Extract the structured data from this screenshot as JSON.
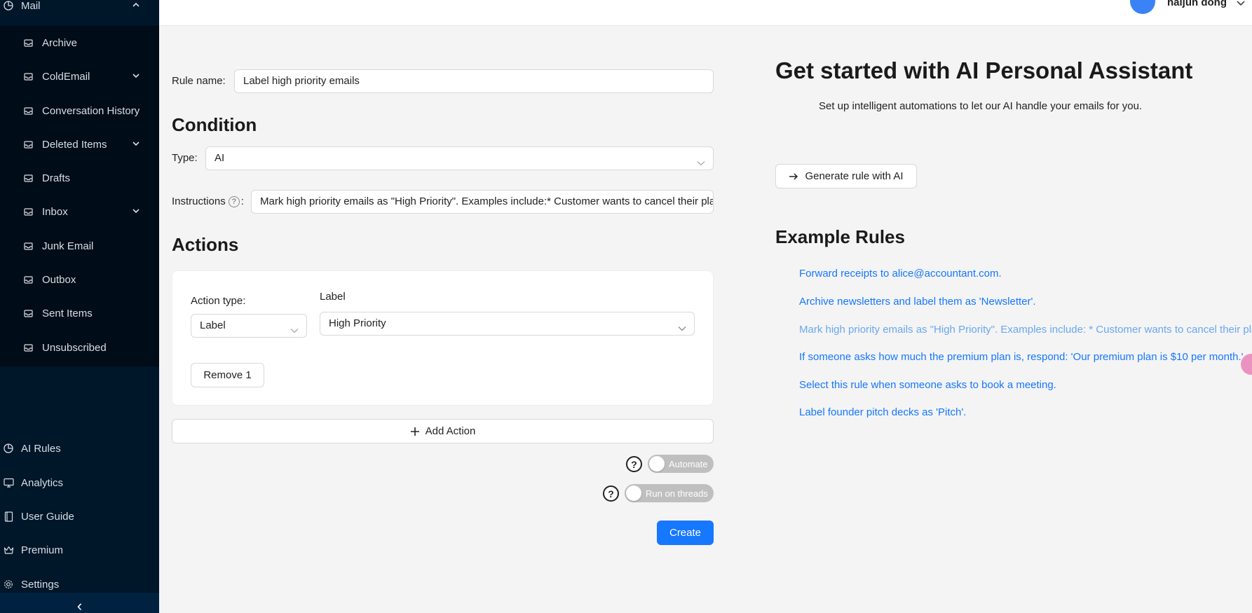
{
  "sidebar": {
    "mail": {
      "label": "Mail",
      "icon": "pie-chart-icon"
    },
    "folders": [
      {
        "label": "Archive",
        "has_children": false
      },
      {
        "label": "ColdEmail",
        "has_children": true
      },
      {
        "label": "Conversation History",
        "has_children": false
      },
      {
        "label": "Deleted Items",
        "has_children": true
      },
      {
        "label": "Drafts",
        "has_children": false
      },
      {
        "label": "Inbox",
        "has_children": true
      },
      {
        "label": "Junk Email",
        "has_children": false
      },
      {
        "label": "Outbox",
        "has_children": false
      },
      {
        "label": "Sent Items",
        "has_children": false
      },
      {
        "label": "Unsubscribed",
        "has_children": false
      }
    ],
    "bottom_items": [
      {
        "label": "AI Rules",
        "icon": "pie-chart-icon"
      },
      {
        "label": "Analytics",
        "icon": "monitor-icon"
      },
      {
        "label": "User Guide",
        "icon": "book-icon"
      },
      {
        "label": "Premium",
        "icon": "crown-icon"
      },
      {
        "label": "Settings",
        "icon": "gear-icon"
      }
    ],
    "collapse_glyph": "‹"
  },
  "header": {
    "user_name": "haijun dong"
  },
  "form": {
    "rule_name_label": "Rule name",
    "rule_name_value": "Label high priority emails",
    "condition_title": "Condition",
    "type_label": "Type",
    "type_value": "AI",
    "instructions_label": "Instructions",
    "instructions_value": "Mark high priority emails as \"High Priority\". Examples include:* Customer wants to cancel their plan",
    "actions_title": "Actions",
    "action_type_label": "Action type",
    "action_type_value": "Label",
    "label_field_label": "Label",
    "label_value": "High Priority",
    "remove_button": "Remove 1",
    "add_action_button": "Add Action",
    "automate_label": "Automate",
    "run_on_threads_label": "Run on threads",
    "create_button": "Create"
  },
  "assistant": {
    "title": "Get started with AI Personal Assistant",
    "subtitle": "Set up intelligent automations to let our AI handle your emails for you.",
    "generate_button": "Generate rule with AI",
    "examples_title": "Example Rules",
    "examples": [
      "Forward receipts to alice@accountant.com.",
      "Archive newsletters and label them as 'Newsletter'.",
      "Mark high priority emails as \"High Priority\". Examples include: * Customer wants to cancel their plan",
      "If someone asks how much the premium plan is, respond: 'Our premium plan is $10 per month.'",
      "Select this rule when someone asks to book a meeting.",
      "Label founder pitch decks as 'Pitch'."
    ]
  },
  "colors": {
    "primary": "#1677ff",
    "sidebar_bg": "#001629",
    "submenu_bg": "#000c17",
    "avatar": "#3b82f6"
  }
}
